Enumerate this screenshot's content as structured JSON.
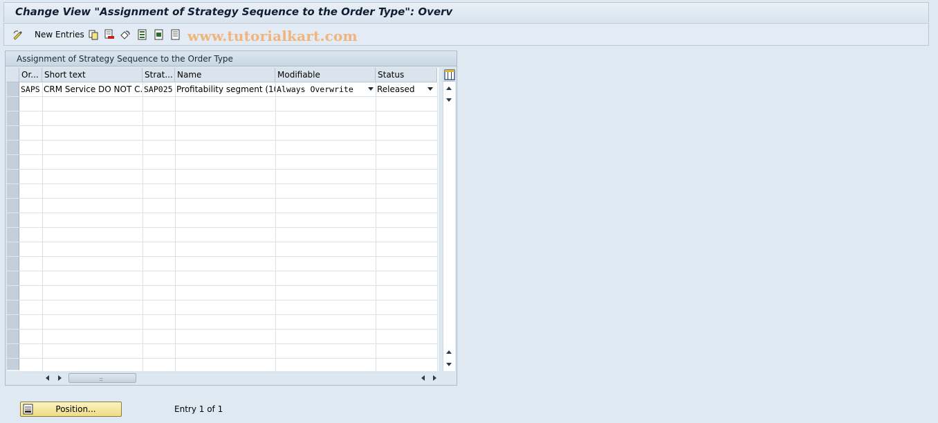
{
  "window": {
    "title": "Change View \"Assignment of Strategy Sequence to the Order Type\": Overv"
  },
  "toolbar": {
    "new_entries_label": "New Entries",
    "icons": [
      "display-change-icon",
      "copy-icon",
      "delete-icon",
      "undo-icon",
      "select-all-icon",
      "select-block-icon",
      "deselect-all-icon"
    ]
  },
  "watermark": "www.tutorialkart.com",
  "table": {
    "title": "Assignment of Strategy Sequence to the Order Type",
    "columns": [
      "Or...",
      "Short text",
      "Strat...",
      "Name",
      "Modifiable",
      "Status"
    ],
    "rows": [
      {
        "order_type": "SAPS",
        "short_text": "CRM Service  DO NOT C...",
        "strategy": "SAP025",
        "name": "Profitability segment (10...",
        "modifiable": "Always Overwrite",
        "status": "Released"
      }
    ]
  },
  "footer": {
    "position_button": "Position...",
    "entry_text": "Entry 1 of 1"
  },
  "colors": {
    "background": "#dfe9f2",
    "button_yellow": "#f0dc83",
    "watermark": "#f0b47c"
  }
}
